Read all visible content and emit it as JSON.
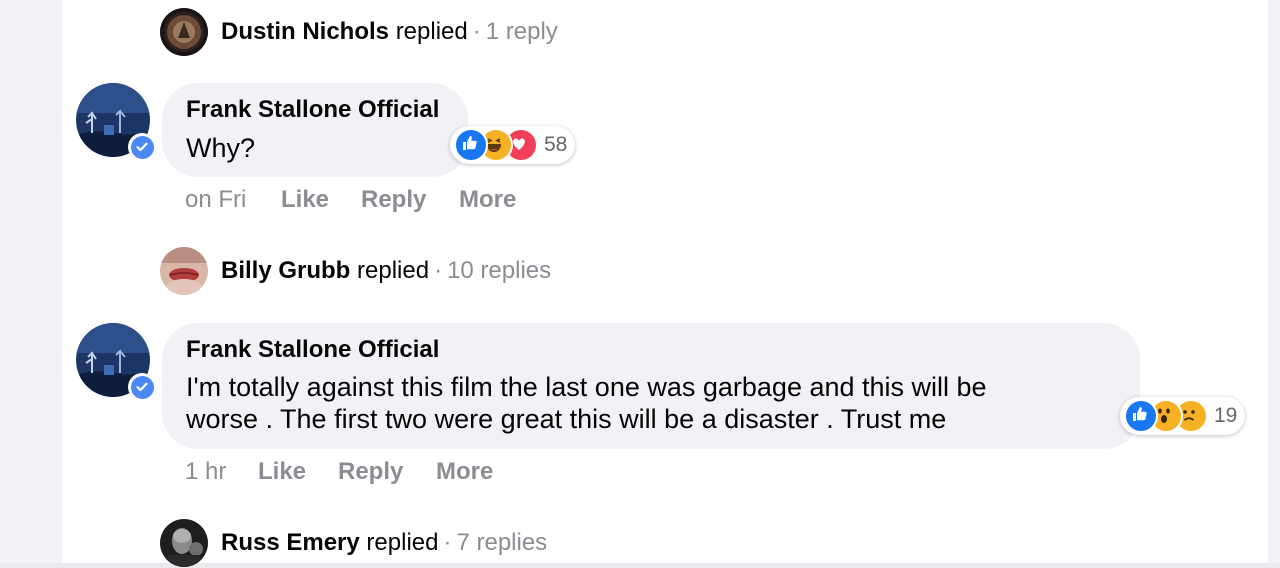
{
  "thread1": {
    "name": "Dustin Nichols",
    "verb": "replied",
    "dot": "·",
    "count": "1 reply"
  },
  "comment1": {
    "author": "Frank Stallone Official",
    "text": "Why?",
    "reactions": {
      "icons": [
        "like-icon",
        "haha-icon",
        "love-icon"
      ],
      "count": "58"
    },
    "time": "on Fri",
    "like": "Like",
    "reply": "Reply",
    "more": "More"
  },
  "thread2": {
    "name": "Billy Grubb",
    "verb": "replied",
    "dot": "·",
    "count": "10 replies"
  },
  "comment2": {
    "author": "Frank Stallone Official",
    "line1": "I'm totally against this film the last one was garbage and this will be",
    "line2": "worse . The first two were great this will be a disaster . Trust me",
    "reactions": {
      "icons": [
        "like-icon",
        "wow-icon",
        "sad-icon"
      ],
      "count": "19"
    },
    "time": "1 hr",
    "like": "Like",
    "reply": "Reply",
    "more": "More"
  },
  "thread3": {
    "name": "Russ Emery",
    "verb": "replied",
    "dot": "·",
    "count": "7 replies"
  },
  "colors": {
    "like": "#1877f2",
    "love": "#f33e58",
    "emoji": "#f7b125",
    "verified": "#4a89f4",
    "bubble": "#f0f2f5",
    "meta_text": "#8a8d91"
  }
}
